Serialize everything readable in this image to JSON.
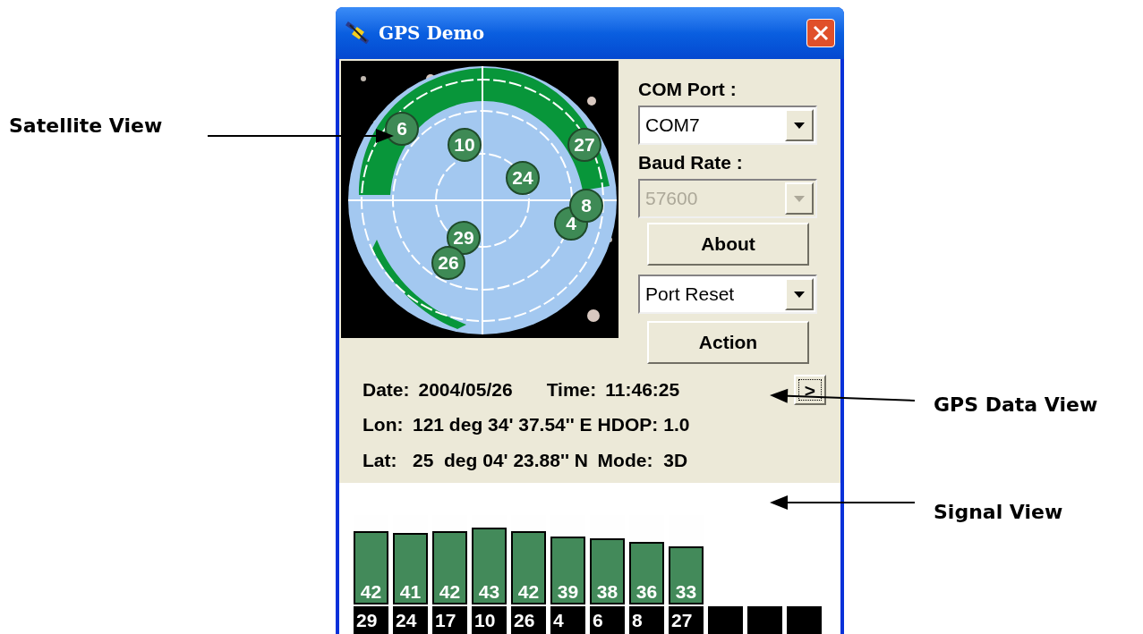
{
  "window": {
    "title": "GPS Demo"
  },
  "satellite_view": {
    "satellites": [
      {
        "label": "6"
      },
      {
        "label": "10"
      },
      {
        "label": "27"
      },
      {
        "label": "24"
      },
      {
        "label": "4"
      },
      {
        "label": "8"
      },
      {
        "label": "29"
      },
      {
        "label": "26"
      }
    ]
  },
  "controls": {
    "com_port": {
      "label": "COM Port :",
      "value": "COM7",
      "disabled": false
    },
    "baud_rate": {
      "label": "Baud Rate :",
      "value": "57600",
      "disabled": true
    },
    "about_button": "About",
    "action_select": {
      "value": "Port Reset",
      "disabled": false
    },
    "action_button": "Action"
  },
  "gps_data": {
    "date": {
      "label": "Date:",
      "value": "2004/05/26"
    },
    "time": {
      "label": "Time:",
      "value": "11:46:25"
    },
    "toggle": ">",
    "lon": {
      "label": "Lon:",
      "value": "121 deg 34' 37.54'' E"
    },
    "hdop": {
      "label": "HDOP:",
      "value": "1.0"
    },
    "lat": {
      "label": "Lat:",
      "value": "25  deg 04' 23.88'' N"
    },
    "mode": {
      "label": "Mode:",
      "value": "3D"
    }
  },
  "signal_view": {
    "channels": [
      {
        "kind": "active",
        "snr": "42",
        "prn": "29",
        "level": 0.82
      },
      {
        "kind": "active",
        "snr": "41",
        "prn": "24",
        "level": 0.8
      },
      {
        "kind": "active",
        "snr": "42",
        "prn": "17",
        "level": 0.82
      },
      {
        "kind": "active",
        "snr": "43",
        "prn": "10",
        "level": 0.86
      },
      {
        "kind": "active",
        "snr": "42",
        "prn": "26",
        "level": 0.82
      },
      {
        "kind": "active",
        "snr": "39",
        "prn": "4",
        "level": 0.76
      },
      {
        "kind": "active",
        "snr": "38",
        "prn": "6",
        "level": 0.74
      },
      {
        "kind": "active",
        "snr": "36",
        "prn": "8",
        "level": 0.7
      },
      {
        "kind": "active",
        "snr": "33",
        "prn": "27",
        "level": 0.65
      },
      {
        "kind": "empty"
      },
      {
        "kind": "empty"
      },
      {
        "kind": "empty"
      }
    ]
  },
  "annotations": [
    {
      "text": "Satellite View"
    },
    {
      "text": "GPS Data View"
    },
    {
      "text": "Signal View"
    }
  ]
}
